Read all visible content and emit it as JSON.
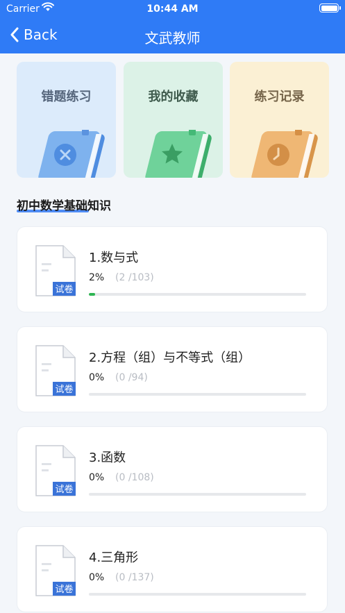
{
  "status_bar": {
    "carrier": "Carrier",
    "time": "10:44 AM"
  },
  "nav": {
    "back_label": "Back",
    "title": "文武教师"
  },
  "cards": [
    {
      "label": "错题练习",
      "icon": "x-icon",
      "book_color": "#6aa3ea",
      "accent": "#3f7ed4"
    },
    {
      "label": "我的收藏",
      "icon": "star-icon",
      "book_color": "#63c98c",
      "accent": "#2f9c5e"
    },
    {
      "label": "练习记录",
      "icon": "clock-icon",
      "book_color": "#ecb06a",
      "accent": "#c9833a"
    }
  ],
  "section": {
    "title": "初中数学基础知识"
  },
  "doc_badge": "试卷",
  "chapters": [
    {
      "title": "1.数与式",
      "percent": "2%",
      "count": "(2 /103)",
      "progress": 0.02
    },
    {
      "title": "2.方程（组）与不等式（组）",
      "percent": "0%",
      "count": "(0 /94)",
      "progress": 0
    },
    {
      "title": "3.函数",
      "percent": "0%",
      "count": "(0 /108)",
      "progress": 0
    },
    {
      "title": "4.三角形",
      "percent": "0%",
      "count": "(0 /137)",
      "progress": 0
    }
  ]
}
